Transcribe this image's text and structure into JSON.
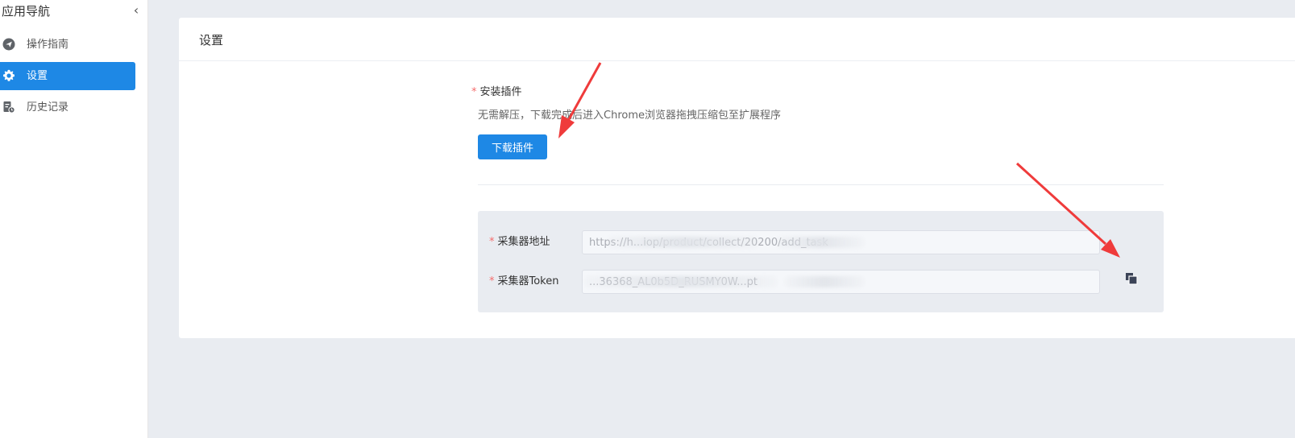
{
  "sidebar": {
    "title": "应用导航",
    "collapse_icon": "chevron-left-icon",
    "items": [
      {
        "label": "操作指南",
        "icon": "paper-plane-icon",
        "active": false
      },
      {
        "label": "设置",
        "icon": "gear-icon",
        "active": true
      },
      {
        "label": "历史记录",
        "icon": "history-doc-icon",
        "active": false
      }
    ]
  },
  "main": {
    "title": "设置",
    "plugin": {
      "label": "安装插件",
      "required_mark": "*",
      "description": "无需解压，下载完成后进入Chrome浏览器拖拽压缩包至扩展程序",
      "download_button": "下载插件"
    },
    "collector": {
      "address_label": "采集器地址",
      "address_value": "https://h...iop/product/collect/20200/add_task",
      "token_label": "采集器Token",
      "token_value": "...36368_AL0b5D_RUSMY0W...pt",
      "copy_icon": "copy-icon"
    }
  },
  "colors": {
    "accent": "#1e88e5",
    "required": "#f56c6c",
    "page_bg": "#e9ecf1",
    "annotation_arrow": "#ef3b3b"
  }
}
